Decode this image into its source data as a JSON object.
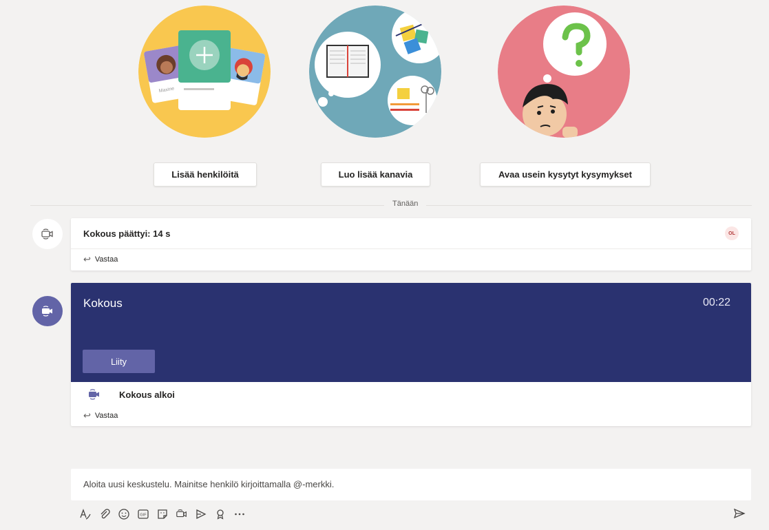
{
  "illustrations": [
    {
      "name": "add-people-illustration",
      "card_name": "Maxine"
    },
    {
      "name": "channels-illustration"
    },
    {
      "name": "faq-illustration"
    }
  ],
  "ctas": {
    "add_people": "Lisää henkilöitä",
    "create_channels": "Luo lisää kanavia",
    "open_faq": "Avaa usein kysytyt kysymykset"
  },
  "divider": {
    "label": "Tänään"
  },
  "messages": [
    {
      "title": "Kokous päättyi: 14 s",
      "participant_initials": "OL",
      "reply_label": "Vastaa"
    },
    {
      "meeting_title": "Kokous",
      "duration": "00:22",
      "join_label": "Liity",
      "status": "Kokous alkoi",
      "reply_label": "Vastaa"
    }
  ],
  "compose": {
    "placeholder": "Aloita uusi keskustelu. Mainitse henkilö kirjoittamalla @-merkki."
  },
  "toolbar": {
    "icons": [
      "format-icon",
      "attach-icon",
      "emoji-icon",
      "gif-icon",
      "sticker-icon",
      "meet-now-icon",
      "stream-icon",
      "praise-icon",
      "more-options-icon"
    ],
    "gif_text": "GIF",
    "send_icon": "send-icon"
  },
  "colors": {
    "accent": "#6264a7",
    "meeting_banner": "#2a3270",
    "background": "#f3f2f1",
    "yellow_circle": "#f9c74f",
    "teal_circle": "#6fa8b8",
    "pink_circle": "#e87d87"
  }
}
